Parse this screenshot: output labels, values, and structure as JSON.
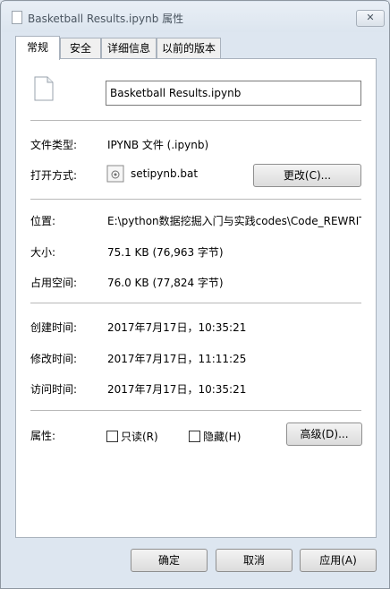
{
  "window": {
    "title": "Basketball Results.ipynb 属性",
    "close_glyph": "✕"
  },
  "tabs": [
    "常规",
    "安全",
    "详细信息",
    "以前的版本"
  ],
  "general": {
    "filename": "Basketball Results.ipynb",
    "type_label": "文件类型:",
    "type_value": "IPYNB 文件 (.ipynb)",
    "opens_label": "打开方式:",
    "opens_value": "setipynb.bat",
    "change_button": "更改(C)...",
    "location_label": "位置:",
    "location_value": "E:\\python数据挖掘入门与实践codes\\Code_REWRIT",
    "size_label": "大小:",
    "size_value": "75.1 KB (76,963 字节)",
    "disk_label": "占用空间:",
    "disk_value": "76.0 KB (77,824 字节)",
    "created_label": "创建时间:",
    "created_value": "2017年7月17日，10:35:21",
    "modified_label": "修改时间:",
    "modified_value": "2017年7月17日，11:11:25",
    "accessed_label": "访问时间:",
    "accessed_value": "2017年7月17日，10:35:21",
    "attributes_label": "属性:",
    "readonly_label": "只读(R)",
    "hidden_label": "隐藏(H)",
    "advanced_button": "高级(D)...",
    "readonly_checked": false,
    "hidden_checked": false
  },
  "footer": {
    "ok": "确定",
    "cancel": "取消",
    "apply": "应用(A)"
  }
}
